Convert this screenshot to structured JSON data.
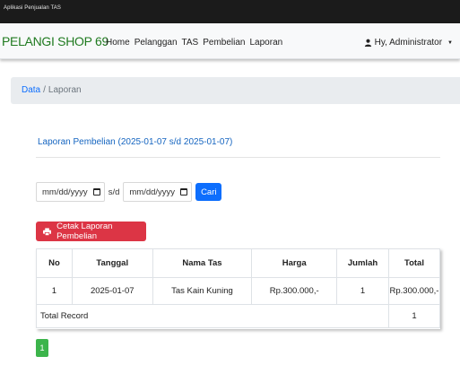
{
  "window": {
    "title": "Aplikasi Penjualan TAS"
  },
  "navbar": {
    "brand": "PELANGI SHOP 69",
    "items": [
      "Home",
      "Pelanggan",
      "TAS",
      "Pembelian",
      "Laporan"
    ],
    "user": "Hy, Administrator"
  },
  "breadcrumb": {
    "link": "Data",
    "separator": "/",
    "current": "Laporan"
  },
  "report": {
    "title": "Laporan Pembelian (2025-01-07 s/d 2025-01-07)"
  },
  "filter": {
    "start_placeholder": "mm/dd/yyyy",
    "separator": "s/d",
    "end_placeholder": "mm/dd/yyyy",
    "search_label": "Cari"
  },
  "print_button": {
    "label": "Cetak Laporan Pembelian"
  },
  "table": {
    "headers": [
      "No",
      "Tanggal",
      "Nama Tas",
      "Harga",
      "Jumlah",
      "Total"
    ],
    "rows": [
      [
        "1",
        "2025-01-07",
        "Tas Kain Kuning",
        "Rp.300.000,-",
        "1",
        "Rp.300.000,-"
      ]
    ],
    "total_label": "Total Record",
    "total_value": "1"
  },
  "pagination": {
    "current": "1"
  },
  "colors": {
    "brand": "#1f7a1f",
    "primary": "#0d6efd",
    "danger": "#dc3545",
    "success": "#3cb44b"
  },
  "icons": {
    "calendar": "calendar-icon",
    "print": "print-icon",
    "user": "user-icon",
    "caret": "caret-down-icon"
  }
}
